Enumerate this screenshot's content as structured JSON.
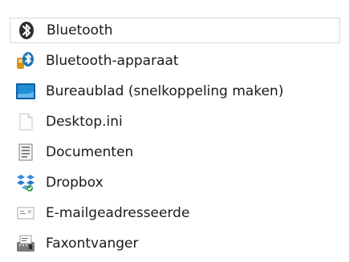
{
  "send_to_menu": {
    "items": [
      {
        "label": "Bluetooth",
        "icon": "bluetooth-icon"
      },
      {
        "label": "Bluetooth-apparaat",
        "icon": "bluetooth-device-icon"
      },
      {
        "label": "Bureaublad (snelkoppeling maken)",
        "icon": "desktop-icon"
      },
      {
        "label": "Desktop.ini",
        "icon": "file-icon"
      },
      {
        "label": "Documenten",
        "icon": "documents-icon"
      },
      {
        "label": "Dropbox",
        "icon": "dropbox-icon"
      },
      {
        "label": "E-mailgeadresseerde",
        "icon": "mail-recipient-icon"
      },
      {
        "label": "Faxontvanger",
        "icon": "fax-recipient-icon"
      }
    ]
  },
  "colors": {
    "text": "#1a1a1a",
    "selection_border": "#d7d7d7",
    "bluetooth": "#1c75bc",
    "desktop": "#1f8ed8",
    "dropbox": "#3a8fe6"
  }
}
